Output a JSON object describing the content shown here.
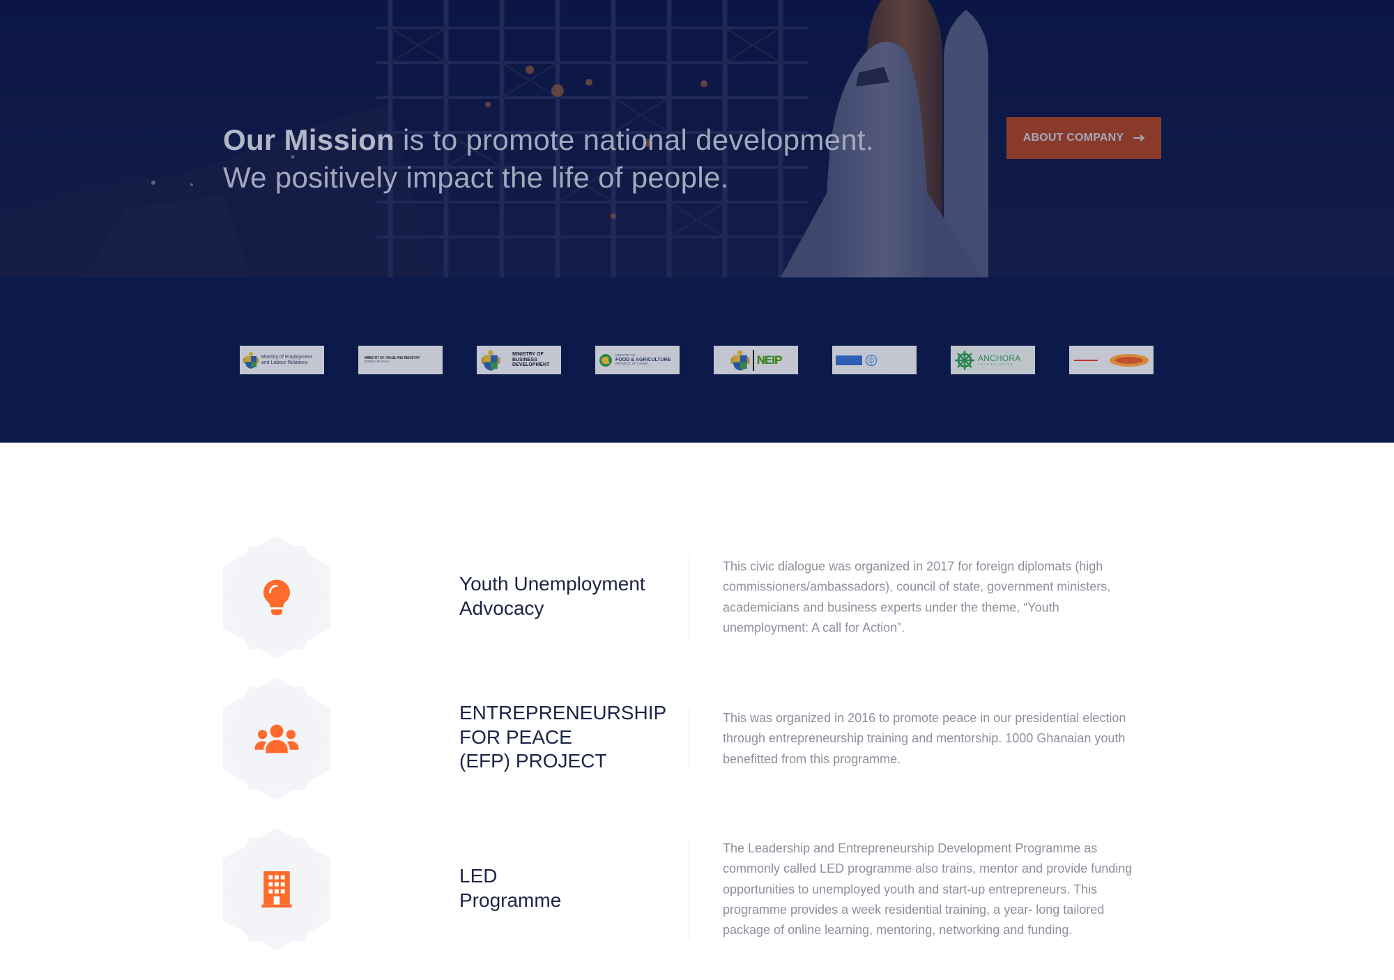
{
  "hero": {
    "mission_bold": "Our Mission",
    "mission_rest": " is to promote national development.",
    "line2": "We positively impact the life of people.",
    "button_label": "ABOUT COMPANY",
    "button_icon": "arrow-right-icon"
  },
  "partners": {
    "logos": [
      {
        "name": "ministry-of-employment-logo",
        "lines": [
          "Ministry of Employment",
          "and Labour Relations"
        ]
      },
      {
        "name": "ministry-of-trade-logo",
        "lines": [
          "MINISTRY OF TRADE AND INDUSTRY",
          "REPUBLIC OF GHANA"
        ]
      },
      {
        "name": "ministry-of-business-development-logo",
        "lines": [
          "MINISTRY OF",
          "BUSINESS",
          "DEVELOPMENT"
        ]
      },
      {
        "name": "ministry-of-food-agriculture-logo",
        "lines": [
          "MINISTRY OF",
          "FOOD & AGRICULTURE",
          "REPUBLIC OF GHANA"
        ]
      },
      {
        "name": "neip-logo",
        "lines": [
          "NEIP"
        ]
      },
      {
        "name": "un-partner-logo",
        "lines": []
      },
      {
        "name": "anchora-technologies-logo",
        "lines": [
          "ANCHORA",
          "TECHNOLOGIES"
        ]
      },
      {
        "name": "partner-logo-8",
        "lines": []
      }
    ]
  },
  "programmes": [
    {
      "icon": "lightbulb-icon",
      "title_lines": [
        "Youth Unemployment",
        "Advocacy"
      ],
      "description": "This civic dialogue was organized in 2017 for foreign diplomats (high commissioners/ambassadors), council of state, government ministers, academicians and business experts under the theme, “Youth unemployment: A call for Action”."
    },
    {
      "icon": "users-icon",
      "title_lines": [
        "ENTREPRENEURSHIP",
        "FOR PEACE",
        "(EFP) PROJECT"
      ],
      "description": "This was organized in 2016 to promote peace in our presidential election through entrepreneurship training and mentorship. 1000 Ghanaian youth benefitted from this programme."
    },
    {
      "icon": "building-icon",
      "title_lines": [
        "LED",
        "Programme"
      ],
      "description": "The Leadership and Entrepreneurship Development Programme as commonly called LED programme also trains, mentor and provide funding opportunities to unemployed youth and start-up entrepreneurs. This programme provides a week residential training, a year- long tailored package of online learning, mentoring, networking and funding."
    }
  ],
  "colors": {
    "accent": "#ff6b2c",
    "navy": "#0c1a4b",
    "button": "#8a3a2b",
    "title": "#1c2444",
    "body_text": "#8d909c"
  }
}
